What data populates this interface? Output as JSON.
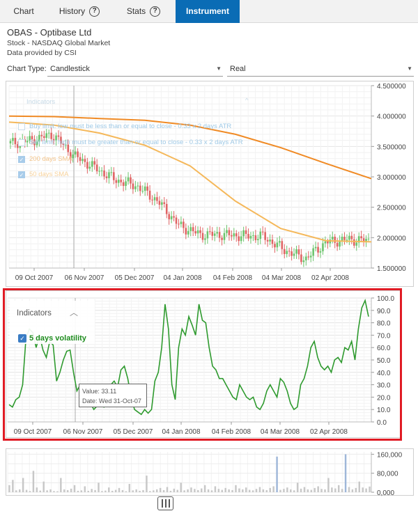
{
  "tabs": [
    {
      "label": "Chart",
      "active": false
    },
    {
      "label": "History",
      "active": false
    },
    {
      "label": "Stats",
      "active": false
    },
    {
      "label": "Instrument",
      "active": true
    }
  ],
  "instrument": {
    "title": "OBAS - Optibase Ltd",
    "line1": "Stock - NASDAQ Global Market",
    "line2": "Data provided by CSI"
  },
  "controls": {
    "chart_type_label": "Chart Type:",
    "chart_type_value": "Candlestick",
    "price_mode_value": "Real"
  },
  "price_chart": {
    "indicators_title": "Indicators",
    "legend": [
      {
        "label": "Buy limit: low must be less than or equal to close - 0.33 x 2 days ATR",
        "checked": false
      },
      {
        "label": "Sell limit: high must be greater than or equal to close - 0.33 x 2 days ATR",
        "checked": false
      },
      {
        "label": "200 days SMA",
        "checked": true
      },
      {
        "label": "50 days SMA",
        "checked": true
      }
    ]
  },
  "volatility_panel": {
    "indicators_title": "Indicators",
    "series_label": "5 days volatility",
    "tooltip_value": "Value: 33.11",
    "tooltip_date": "Date: Wed 31-Oct-07"
  },
  "colors": {
    "tab_active": "#0a6cb5",
    "bull": "#6cc46c",
    "bear": "#e06464",
    "sma200": "#f08a24",
    "sma50": "#f5b85a",
    "volatility": "#2e9a2e",
    "highlight": "#e01b24",
    "volume": "#c8c8c8"
  },
  "chart_data": [
    {
      "type": "line",
      "title": "",
      "subtitle": "price",
      "x_tick_labels": [
        "09 Oct 2007",
        "06 Nov 2007",
        "05 Dec 2007",
        "04 Jan 2008",
        "04 Feb 2008",
        "04 Mar 2008",
        "02 Apr 2008"
      ],
      "y_tick_labels": [
        "4.500000",
        "4.000000",
        "3.500000",
        "3.000000",
        "2.500000",
        "2.000000",
        "1.500000"
      ],
      "ylim": [
        1.5,
        4.5
      ],
      "series": [
        {
          "name": "200 days SMA",
          "x": [
            "27-Sep-07",
            "09-Oct-07",
            "06-Nov-07",
            "05-Dec-07",
            "04-Jan-08",
            "04-Feb-08",
            "04-Mar-08",
            "02-Apr-08",
            "17-Apr-08"
          ],
          "values": [
            4.0,
            3.99,
            3.96,
            3.93,
            3.85,
            3.7,
            3.48,
            3.22,
            2.97
          ]
        },
        {
          "name": "50 days SMA",
          "x": [
            "27-Sep-07",
            "09-Oct-07",
            "06-Nov-07",
            "05-Dec-07",
            "04-Jan-08",
            "04-Feb-08",
            "04-Mar-08",
            "02-Apr-08",
            "17-Apr-08"
          ],
          "values": [
            3.9,
            3.85,
            3.72,
            3.52,
            3.18,
            2.6,
            2.15,
            1.95,
            1.93
          ]
        },
        {
          "name": "close",
          "x": [
            "27-Sep-07",
            "09-Oct-07",
            "25-Oct-07",
            "06-Nov-07",
            "20-Nov-07",
            "05-Dec-07",
            "18-Dec-07",
            "04-Jan-08",
            "15-Jan-08",
            "25-Jan-08",
            "04-Feb-08",
            "18-Feb-08",
            "04-Mar-08",
            "12-Mar-08",
            "20-Mar-08",
            "02-Apr-08",
            "10-Apr-08",
            "17-Apr-08"
          ],
          "values": [
            3.55,
            3.6,
            3.7,
            3.35,
            3.15,
            2.95,
            2.85,
            2.6,
            2.2,
            2.05,
            2.05,
            2.03,
            2.02,
            1.8,
            1.65,
            1.93,
            1.97,
            1.95
          ]
        }
      ]
    },
    {
      "type": "line",
      "title": "",
      "x_tick_labels": [
        "09 Oct 2007",
        "06 Nov 2007",
        "05 Dec 2007",
        "04 Jan 2008",
        "04 Feb 2008",
        "04 Mar 2008",
        "02 Apr 2008"
      ],
      "y_tick_labels": [
        "100.0",
        "90.0",
        "80.0",
        "70.0",
        "60.0",
        "50.0",
        "40.0",
        "30.0",
        "20.0",
        "10.0",
        "0.0"
      ],
      "ylim": [
        0,
        100
      ],
      "series": [
        {
          "name": "5 days volatility",
          "values": [
            14,
            12,
            18,
            20,
            30,
            68,
            75,
            72,
            60,
            70,
            58,
            52,
            65,
            62,
            33,
            40,
            50,
            57,
            58,
            40,
            25,
            30,
            22,
            18,
            15,
            10,
            13,
            20,
            12,
            15,
            30,
            33,
            28,
            42,
            45,
            35,
            20,
            10,
            8,
            6,
            10,
            7,
            10,
            33,
            40,
            60,
            95,
            75,
            30,
            18,
            60,
            75,
            70,
            85,
            78,
            70,
            95,
            82,
            80,
            60,
            45,
            42,
            35,
            35,
            30,
            25,
            20,
            18,
            30,
            25,
            20,
            18,
            20,
            12,
            10,
            15,
            25,
            30,
            25,
            20,
            35,
            32,
            25,
            15,
            10,
            12,
            30,
            35,
            45,
            60,
            65,
            52,
            45,
            42,
            45,
            40,
            50,
            52,
            48,
            60,
            58,
            65,
            50,
            75,
            92,
            98,
            85
          ]
        }
      ]
    },
    {
      "type": "bar",
      "title": "",
      "subtitle": "volume",
      "y_tick_labels": [
        "160,000",
        "80,000",
        "0,000"
      ],
      "ylim": [
        0,
        170000
      ],
      "values": [
        30000,
        52000,
        8000,
        12000,
        60000,
        10000,
        5000,
        90000,
        20000,
        7000,
        45000,
        8000,
        12000,
        5000,
        4000,
        60000,
        12000,
        9000,
        15000,
        30000,
        6000,
        8000,
        25000,
        6000,
        14000,
        9000,
        40000,
        5000,
        7000,
        20000,
        6000,
        10000,
        18000,
        9000,
        4000,
        35000,
        8000,
        12000,
        6000,
        9000,
        70000,
        5000,
        8000,
        12000,
        18000,
        9000,
        22000,
        6000,
        15000,
        10000,
        40000,
        8000,
        12000,
        20000,
        14000,
        9000,
        16000,
        30000,
        12000,
        8000,
        25000,
        14000,
        10000,
        18000,
        12000,
        9000,
        30000,
        16000,
        12000,
        20000,
        10000,
        8000,
        14000,
        22000,
        12000,
        9000,
        18000,
        25000,
        150000,
        10000,
        14000,
        20000,
        12000,
        8000,
        40000,
        15000,
        22000,
        12000,
        10000,
        18000,
        25000,
        14000,
        12000,
        60000,
        20000,
        16000,
        30000,
        14000,
        160000,
        22000,
        12000,
        18000,
        45000,
        20000,
        16000,
        24000
      ]
    }
  ]
}
